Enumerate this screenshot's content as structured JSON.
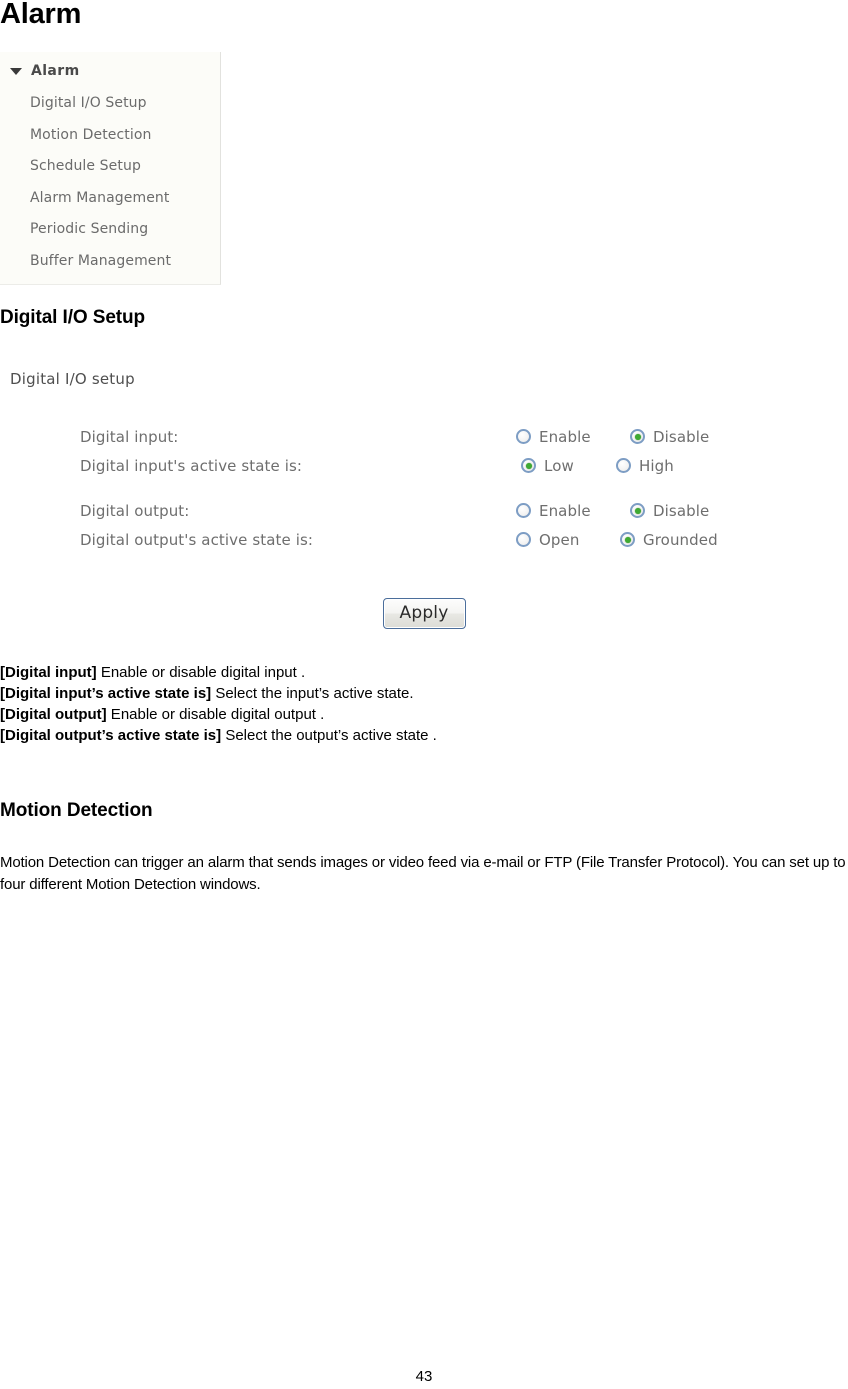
{
  "page": {
    "title": "Alarm",
    "number": "43"
  },
  "sidebar": {
    "root_label": "Alarm",
    "expand_icon": "triangle-down-icon",
    "items": [
      {
        "label": "Digital I/O Setup"
      },
      {
        "label": "Motion Detection"
      },
      {
        "label": "Schedule Setup"
      },
      {
        "label": "Alarm Management"
      },
      {
        "label": "Periodic Sending"
      },
      {
        "label": "Buffer Management"
      }
    ]
  },
  "sections": {
    "digital_io": {
      "heading": "Digital I/O Setup",
      "panel_title": "Digital I/O setup",
      "rows": [
        {
          "label": "Digital input:",
          "options": [
            {
              "label": "Enable",
              "checked": false
            },
            {
              "label": "Disable",
              "checked": true
            }
          ]
        },
        {
          "label": "Digital input's active state is:",
          "options": [
            {
              "label": "Low",
              "checked": true
            },
            {
              "label": "High",
              "checked": false
            }
          ]
        },
        {
          "label": "Digital output:",
          "options": [
            {
              "label": "Enable",
              "checked": false
            },
            {
              "label": "Disable",
              "checked": true
            }
          ]
        },
        {
          "label": "Digital output's active state is:",
          "options": [
            {
              "label": "Open",
              "checked": false
            },
            {
              "label": "Grounded",
              "checked": true
            }
          ]
        }
      ],
      "apply_label": "Apply",
      "definitions": [
        {
          "term": "[Digital input]",
          "desc": " Enable or disable digital input ."
        },
        {
          "term": "[Digital input’s active state is]",
          "desc": " Select the input’s active state."
        },
        {
          "term": "[Digital output]",
          "desc": " Enable or disable digital output ."
        },
        {
          "term": "[Digital output’s active state is]",
          "desc": " Select the output’s active state ."
        }
      ]
    },
    "motion_detection": {
      "heading": "Motion Detection",
      "paragraph": "Motion Detection can trigger an alarm that sends images or video feed via e-mail or FTP (File Transfer Protocol). You can set up to four different Motion Detection windows."
    }
  },
  "colors": {
    "radio_ring": "#7d9dc4",
    "radio_dot": "#3faa33",
    "button_border": "#4b6e9b",
    "panel_bg": "#fcfcf8",
    "menu_text": "#6b6b6b"
  }
}
